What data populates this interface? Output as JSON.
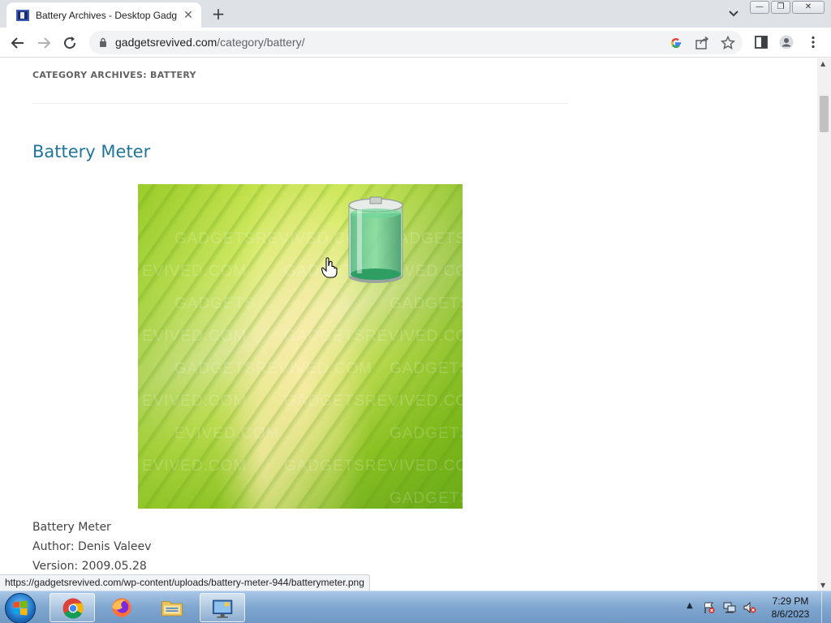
{
  "browser": {
    "tab_title": "Battery Archives - Desktop Gadg",
    "tab_close": "✕",
    "new_tab": "+",
    "url_domain": "gadgetsrevived.com",
    "url_path": "/category/battery/",
    "window_controls": {
      "minimize": "—",
      "restore": "❐",
      "close": "✕"
    }
  },
  "page": {
    "archive_title": "CATEGORY ARCHIVES: BATTERY",
    "post_title": "Battery Meter",
    "image_watermarks": [
      "GADGETSREVIVED.COM",
      "GADGETS",
      "EVIVED.COM",
      "GADGETSREVIVED.COM",
      "GADGETS",
      "EVIVED.COM",
      "GADGETSREVIVED.COM",
      "GADGETS",
      "EVIVED.COM",
      "GADGETSREVIVED.COM",
      "GADGETS",
      "EVIVED.COM",
      "GADGETSREVIVED.COM",
      "GADGETS",
      "EVIVED.COM",
      "GADGETSREVIVED.COM",
      "GADGETS"
    ],
    "meta": {
      "name": "Battery Meter",
      "author": "Author: Denis Valeev",
      "version": "Version: 2009.05.28"
    }
  },
  "status_url": "https://gadgetsrevived.com/wp-content/uploads/battery-meter-944/batterymeter.png",
  "taskbar": {
    "time": "7:29 PM",
    "date": "8/6/2023",
    "tray_expand": "▲"
  },
  "scrollbar": {
    "up": "▲",
    "down": "▼",
    "thumb_position": 0.05
  }
}
